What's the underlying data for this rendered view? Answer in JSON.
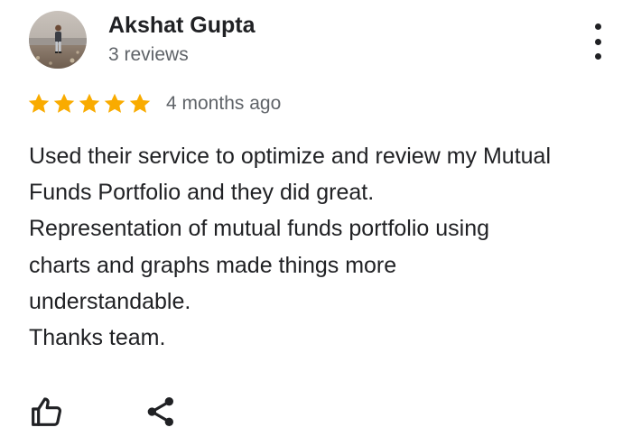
{
  "reviewer": {
    "name": "Akshat Gupta",
    "review_count": "3 reviews"
  },
  "rating": {
    "stars": 5,
    "max_stars": 5,
    "star_color": "#F9AB00",
    "date": "4 months ago"
  },
  "review": {
    "lines": [
      "Used their service to optimize and review my Mutual",
      "Funds Portfolio and they did great.",
      "Representation of mutual funds portfolio using",
      "charts and graphs made things more",
      "understandable.",
      "Thanks team."
    ]
  },
  "icons": {
    "menu": "more-vert-icon",
    "like": "thumb-up-icon",
    "share": "share-icon"
  },
  "colors": {
    "text_primary": "#202124",
    "text_secondary": "#5f6368",
    "star": "#F9AB00"
  }
}
